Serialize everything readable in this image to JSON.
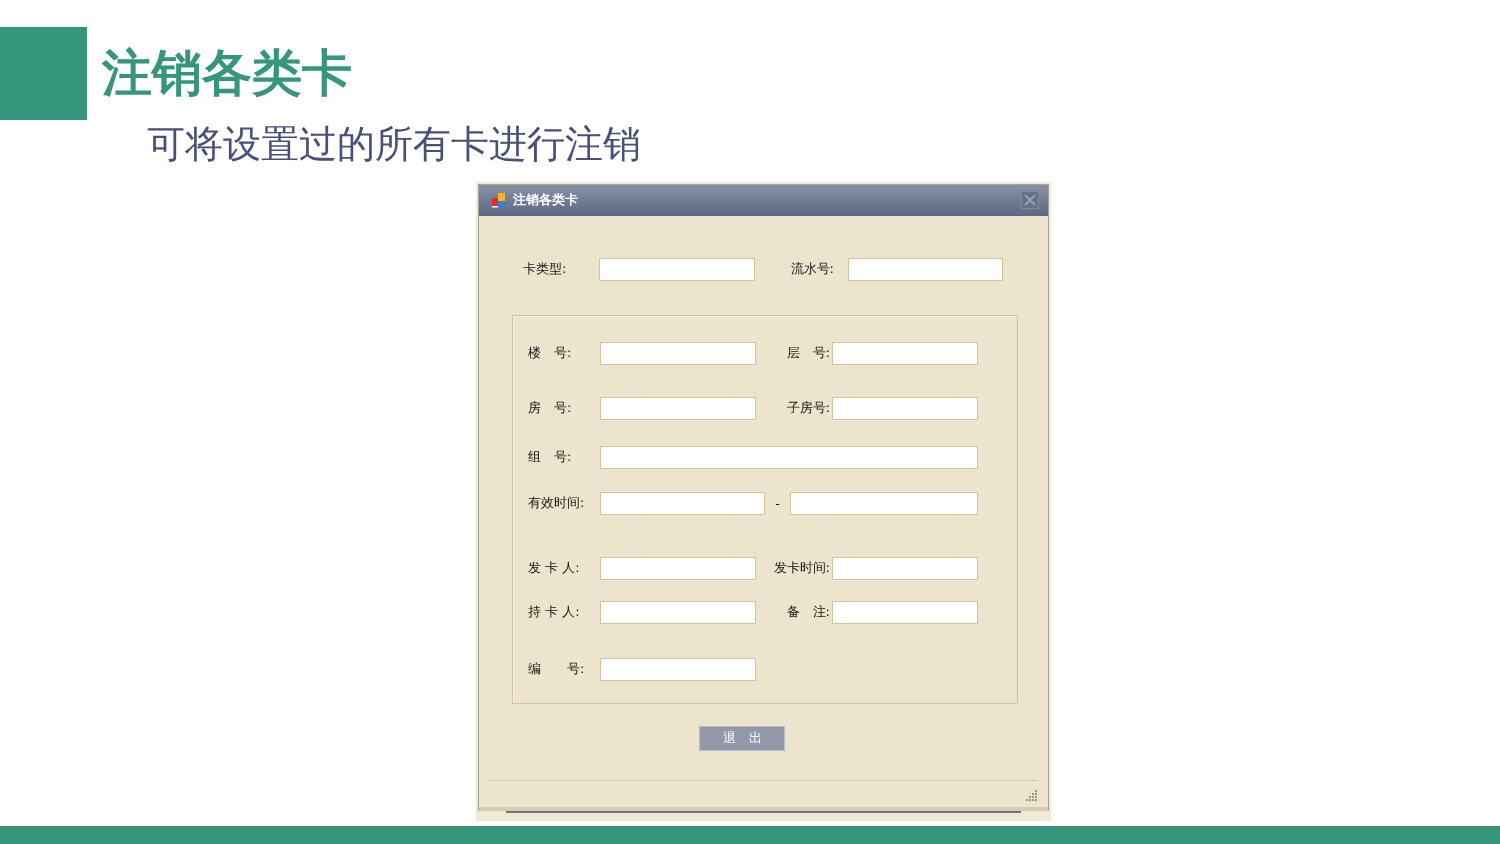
{
  "slide": {
    "title": "注销各类卡",
    "subtitle": "可将设置过的所有卡进行注销"
  },
  "dialog": {
    "title": "注销各类卡",
    "top_row": [
      {
        "kind": "field",
        "label": "卡类型:"
      },
      {
        "kind": "field",
        "label": "流水号:"
      }
    ],
    "group_rows": [
      [
        {
          "kind": "field",
          "label": "楼　号:"
        },
        {
          "kind": "field",
          "label": "层　号:"
        }
      ],
      [
        {
          "kind": "field",
          "label": "房　号:"
        },
        {
          "kind": "field",
          "label": "子房号:"
        }
      ],
      [
        {
          "kind": "wide",
          "label": "组　号:"
        }
      ],
      [
        {
          "kind": "range",
          "label": "有效时间:",
          "separator": "-"
        }
      ],
      [
        {
          "kind": "field",
          "label": "发 卡 人:"
        },
        {
          "kind": "field",
          "label": "发卡时间:"
        }
      ],
      [
        {
          "kind": "field",
          "label": "持 卡 人:"
        },
        {
          "kind": "field",
          "label": "备　注:"
        }
      ],
      [
        {
          "kind": "field",
          "label": "编　　号:"
        }
      ]
    ],
    "buttons": [
      "退　出"
    ]
  }
}
